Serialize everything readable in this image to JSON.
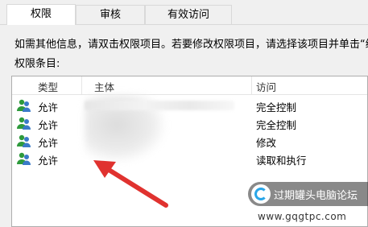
{
  "tabs": [
    {
      "label": "权限"
    },
    {
      "label": "审核"
    },
    {
      "label": "有效访问"
    }
  ],
  "info_text": "如需其他信息，请双击权限项目。若要修改权限项目，请选择该项目并单击“编",
  "entries_label": "权限条目:",
  "columns": {
    "type": "类型",
    "subject": "主体",
    "access": "访问"
  },
  "rows": [
    {
      "type": "允许",
      "access": "完全控制"
    },
    {
      "type": "允许",
      "access": "完全控制"
    },
    {
      "type": "允许",
      "access": "修改"
    },
    {
      "type": "允许",
      "access": "读取和执行"
    }
  ],
  "watermark": {
    "text": "过期罐头电脑论坛",
    "url": "www.gqgtpc.com"
  },
  "colors": {
    "arrow": "#e0322f",
    "user_icon_green": "#2e9a3c",
    "user_icon_blue": "#3a7ac8"
  }
}
